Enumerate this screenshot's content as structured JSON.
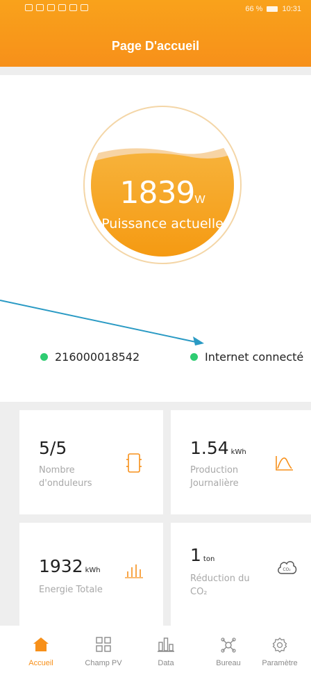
{
  "status_bar": {
    "battery": "66 %",
    "time": "10:31"
  },
  "header": {
    "title": "Page D'accueil"
  },
  "gauge": {
    "power_value": "1839",
    "power_unit": "W",
    "label": "Puissance actuelle"
  },
  "status": {
    "serial": "216000018542",
    "connection": "Internet connecté",
    "dot_color": "#2ecc71"
  },
  "tiles": [
    {
      "value": "5/5",
      "unit": "",
      "label_line1": "Nombre",
      "label_line2": "d'onduleurs",
      "icon": "inverter-icon"
    },
    {
      "value": "1.54",
      "unit": "kWh",
      "label_line1": "Production",
      "label_line2": "Journalière",
      "icon": "production-curve-icon"
    },
    {
      "value": "1932",
      "unit": "kWh",
      "label_line1": "Energie Totale",
      "label_line2": "",
      "icon": "bar-chart-icon"
    },
    {
      "value": "1",
      "unit": "ton",
      "label_line1": "Réduction du",
      "label_line2": "CO₂",
      "icon": "co2-cloud-icon"
    }
  ],
  "nav": [
    {
      "label": "Accueil",
      "icon": "home-icon",
      "active": true
    },
    {
      "label": "Champ PV",
      "icon": "grid-icon",
      "active": false
    },
    {
      "label": "Data",
      "icon": "data-icon",
      "active": false
    },
    {
      "label": "Bureau",
      "icon": "bureau-icon",
      "active": false
    },
    {
      "label": "Paramètre",
      "icon": "settings-icon",
      "active": false
    }
  ],
  "colors": {
    "accent": "#f7901a",
    "header": "#f9a21b",
    "online": "#2ecc71",
    "annotation": "#2a9ac4"
  }
}
